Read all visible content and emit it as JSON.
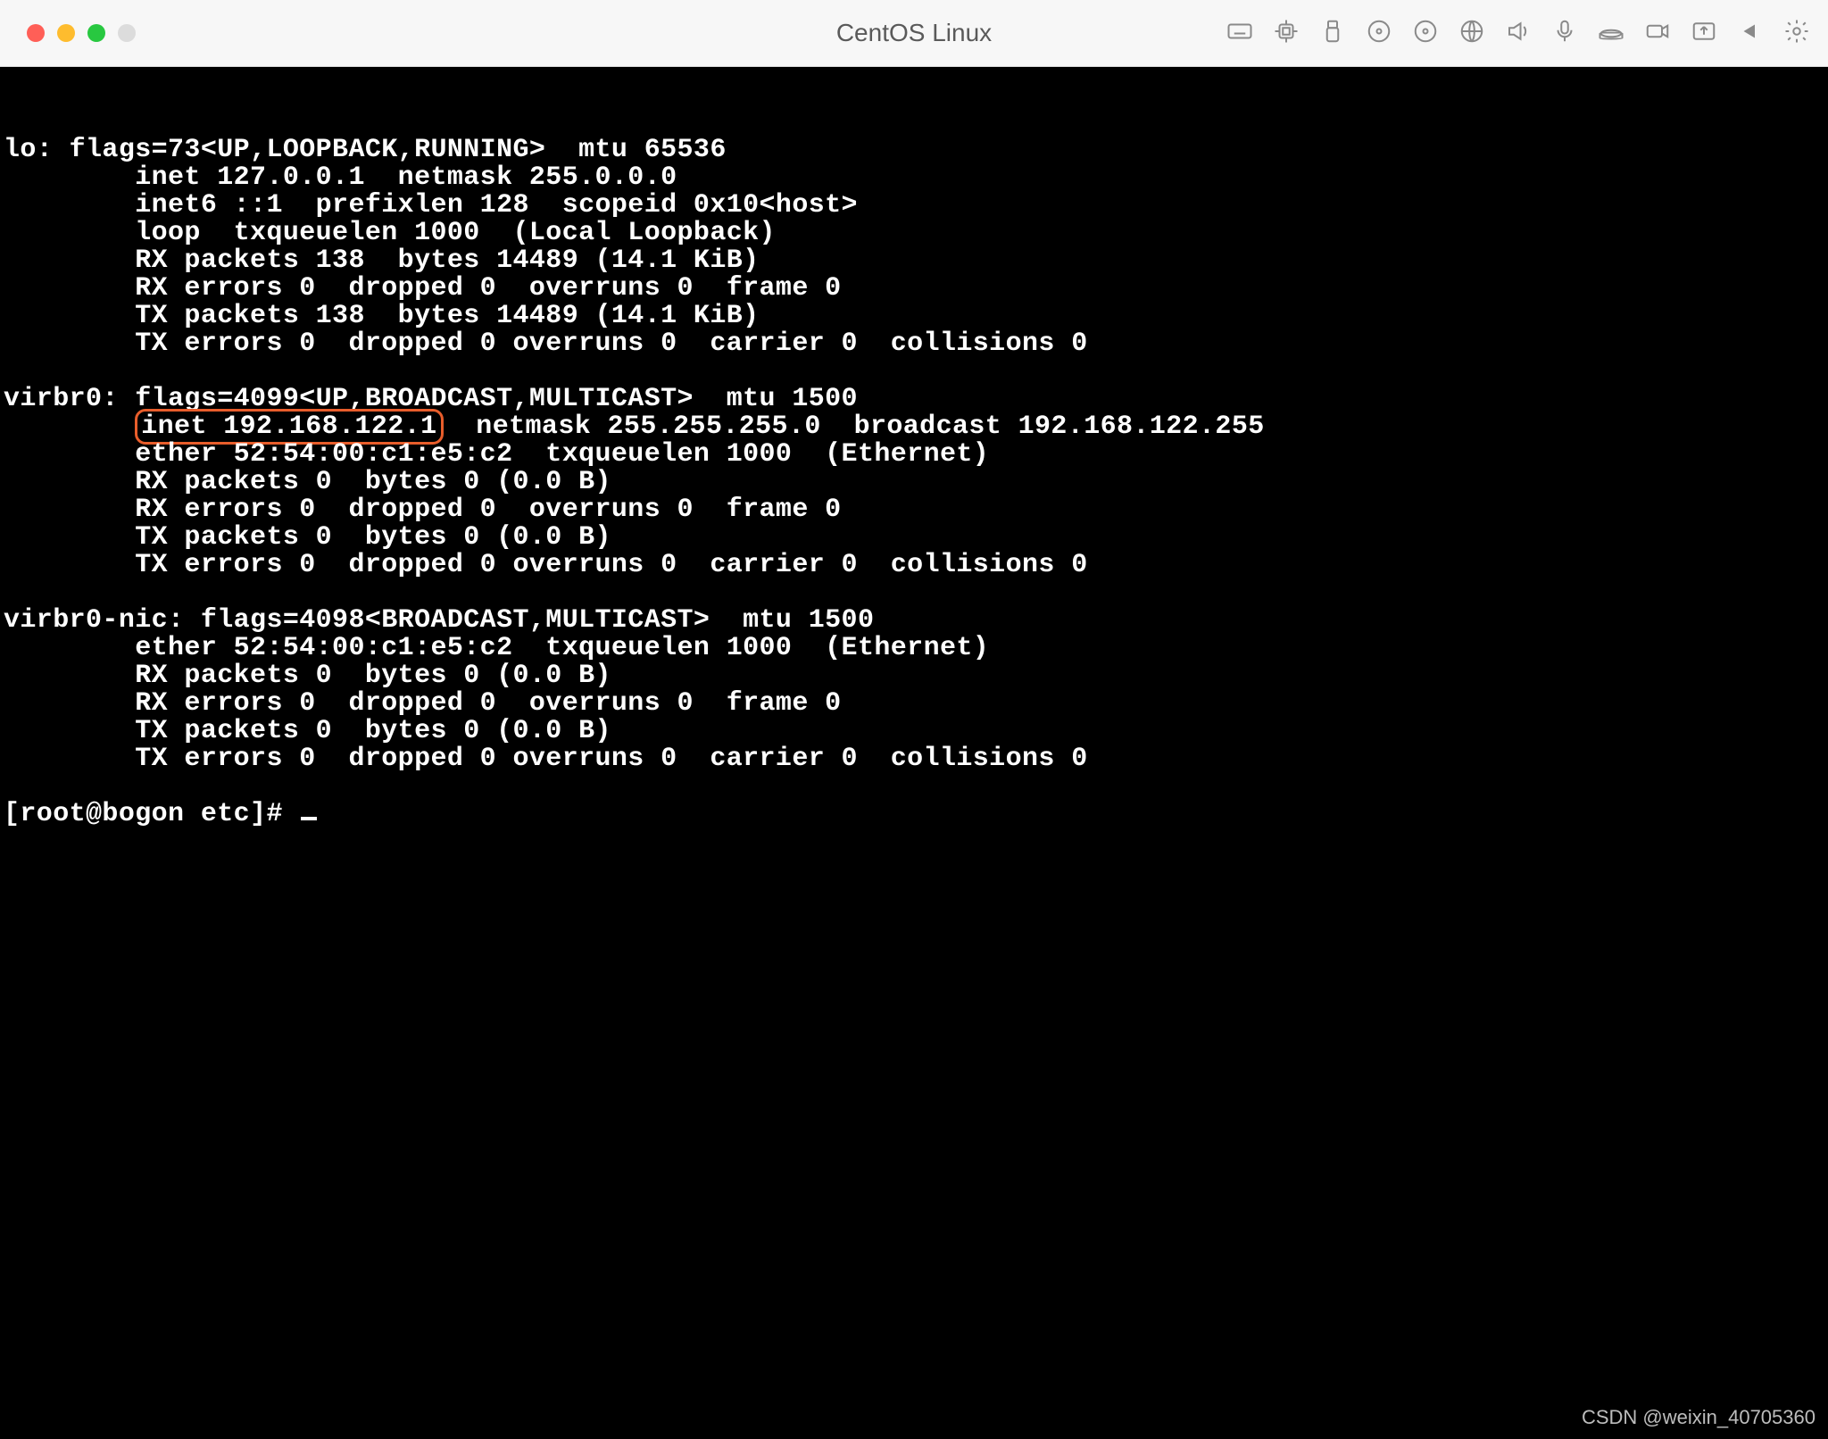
{
  "window": {
    "title": "CentOS Linux"
  },
  "toolbar_icons": [
    "keyboard-icon",
    "cpu-icon",
    "usb-icon",
    "disc1-icon",
    "disc2-icon",
    "globe-icon",
    "volume-icon",
    "mic-icon",
    "disk-icon",
    "camera-icon",
    "share-icon",
    "play-back-icon",
    "gear-icon"
  ],
  "terminal": {
    "lines": [
      "",
      "",
      "lo: flags=73<UP,LOOPBACK,RUNNING>  mtu 65536",
      "        inet 127.0.0.1  netmask 255.0.0.0",
      "        inet6 ::1  prefixlen 128  scopeid 0x10<host>",
      "        loop  txqueuelen 1000  (Local Loopback)",
      "        RX packets 138  bytes 14489 (14.1 KiB)",
      "        RX errors 0  dropped 0  overruns 0  frame 0",
      "        TX packets 138  bytes 14489 (14.1 KiB)",
      "        TX errors 0  dropped 0 overruns 0  carrier 0  collisions 0",
      "",
      "virbr0: flags=4099<UP,BROADCAST,MULTICAST>  mtu 1500",
      "",
      "        ether 52:54:00:c1:e5:c2  txqueuelen 1000  (Ethernet)",
      "        RX packets 0  bytes 0 (0.0 B)",
      "        RX errors 0  dropped 0  overruns 0  frame 0",
      "        TX packets 0  bytes 0 (0.0 B)",
      "        TX errors 0  dropped 0 overruns 0  carrier 0  collisions 0",
      "",
      "virbr0-nic: flags=4098<BROADCAST,MULTICAST>  mtu 1500",
      "        ether 52:54:00:c1:e5:c2  txqueuelen 1000  (Ethernet)",
      "        RX packets 0  bytes 0 (0.0 B)",
      "        RX errors 0  dropped 0  overruns 0  frame 0",
      "        TX packets 0  bytes 0 (0.0 B)",
      "        TX errors 0  dropped 0 overruns 0  carrier 0  collisions 0",
      ""
    ],
    "highlight_line": {
      "prefix": "        ",
      "hl": "inet 192.168.122.1",
      "suffix": "  netmask 255.255.255.0  broadcast 192.168.122.255"
    },
    "prompt": "[root@bogon etc]# "
  },
  "watermark": "CSDN @weixin_40705360"
}
